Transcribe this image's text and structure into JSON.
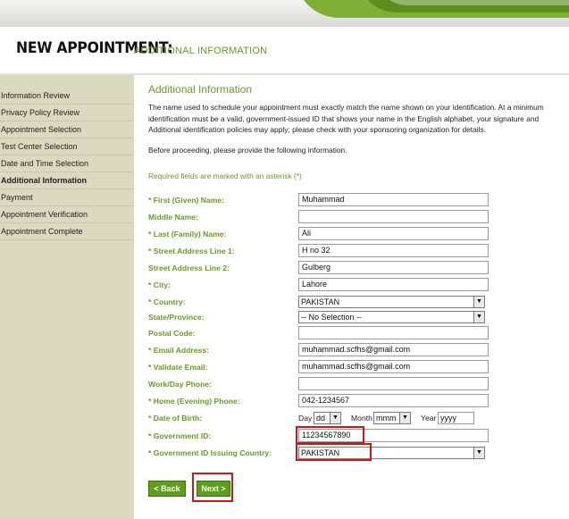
{
  "page": {
    "title_main": "NEW APPOINTMENT:",
    "title_sub": "ADDITIONAL INFORMATION"
  },
  "sidebar": {
    "items": [
      {
        "label": "Information Review"
      },
      {
        "label": "Privacy Policy Review"
      },
      {
        "label": "Appointment Selection"
      },
      {
        "label": "Test Center Selection"
      },
      {
        "label": "Date and Time Selection"
      },
      {
        "label": "Additional Information"
      },
      {
        "label": "Payment"
      },
      {
        "label": "Appointment Verification"
      },
      {
        "label": "Appointment Complete"
      }
    ],
    "active_index": 5
  },
  "content": {
    "heading": "Additional Information",
    "para_line1": "The name used to schedule your appointment must exactly match the name shown on your identification. At a minimum",
    "para_line2": "identification must be a valid, government-issued ID that shows your name in the English alphabet, your signature and",
    "para_line3": "Additional identification policies may apply; please check with your sponsoring organization for details.",
    "before_text": "Before proceeding, please provide the following information.",
    "required_note": "Required fields are marked with an asterisk (*)"
  },
  "form": {
    "first_name": {
      "label": "* First (Given) Name:",
      "value": "Muhammad"
    },
    "middle_name": {
      "label": "Middle Name:",
      "value": ""
    },
    "last_name": {
      "label": "* Last (Family) Name:",
      "value": "Ali"
    },
    "street1": {
      "label": "* Street Address Line 1:",
      "value": "H no 32"
    },
    "street2": {
      "label": "Street Address Line 2:",
      "value": "Gulberg"
    },
    "city": {
      "label": "* City:",
      "value": "Lahore"
    },
    "country": {
      "label": "* Country:",
      "value": "PAKISTAN"
    },
    "state": {
      "label": "State/Province:",
      "value": "-- No Selection --"
    },
    "postal": {
      "label": "Postal Code:",
      "value": ""
    },
    "email": {
      "label": "* Email Address:",
      "value": "muhammad.scfhs@gmail.com"
    },
    "validate_email": {
      "label": "* Validate Email:",
      "value": "muhammad.scfhs@gmail.com"
    },
    "work_phone": {
      "label": "Work/Day Phone:",
      "value": ""
    },
    "home_phone": {
      "label": "* Home (Evening) Phone:",
      "value": "042-1234567"
    },
    "dob": {
      "label": "* Date of Birth:",
      "day_label": "Day",
      "day_value": "dd",
      "month_label": "Month",
      "month_value": "mmm",
      "year_label": "Year",
      "year_value": "yyyy"
    },
    "gov_id": {
      "label": "* Government ID:",
      "value": "11234567890"
    },
    "gov_country": {
      "label": "* Government ID Issuing Country:",
      "value": "PAKISTAN"
    }
  },
  "buttons": {
    "back": "< Back",
    "next": "Next >"
  },
  "colors": {
    "accent_green": "#6a9a2a",
    "button_green": "#5e9e1c",
    "sidebar_bg": "#ddd9c0",
    "highlight_red": "#d0161c"
  }
}
